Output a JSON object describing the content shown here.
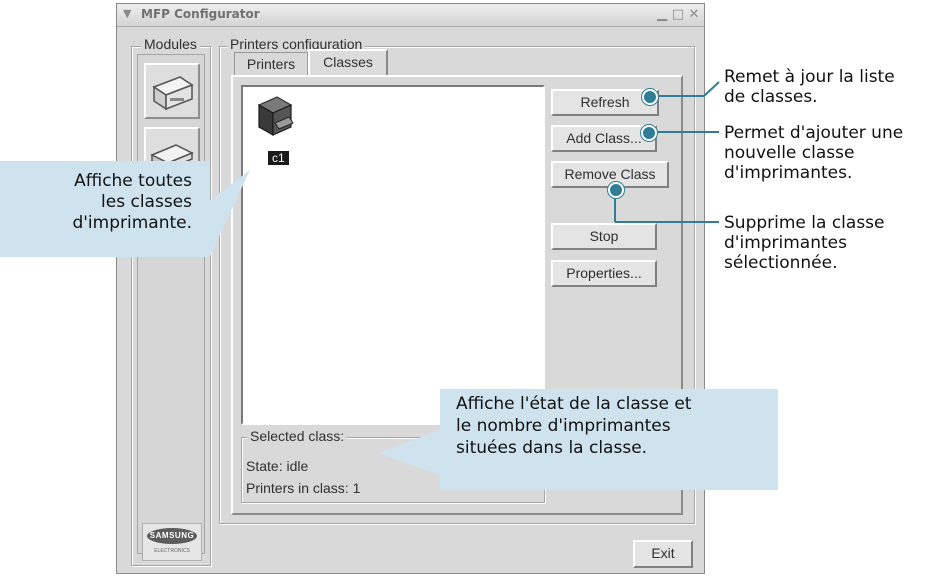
{
  "window": {
    "title": "MFP Configurator"
  },
  "modules": {
    "label": "Modules",
    "logo_text": "SAMSUNG",
    "logo_subtext": "ELECTRONICS"
  },
  "printers_config": {
    "label": "Printers configuration",
    "tabs": [
      "Printers",
      "Classes"
    ],
    "active_tab": "Classes",
    "class_items": [
      {
        "name": "c1",
        "icon": "printer-icon"
      }
    ],
    "buttons": {
      "refresh": "Refresh",
      "add_class": "Add Class...",
      "remove_class": "Remove Class",
      "stop": "Stop",
      "properties": "Properties..."
    },
    "selected_class": {
      "label": "Selected class:",
      "state": "State: idle",
      "printers_count": "Printers in class: 1"
    }
  },
  "footer": {
    "exit": "Exit"
  },
  "annotations": {
    "all_classes": [
      "Affiche toutes",
      "les classes",
      "d'imprimante."
    ],
    "status": [
      "Affiche l'état de la classe et",
      "le nombre d'imprimantes",
      "situées dans la classe."
    ],
    "refresh": [
      "Remet à jour la liste",
      "de classes."
    ],
    "add": [
      "Permet d'ajouter une",
      "nouvelle classe",
      "d'imprimantes."
    ],
    "remove": [
      "Supprime la classe",
      "d'imprimantes",
      "sélectionnée."
    ]
  },
  "colors": {
    "accent": "#2f7d96",
    "callout": "#cfe3ef",
    "window": "#d9d9d9"
  }
}
